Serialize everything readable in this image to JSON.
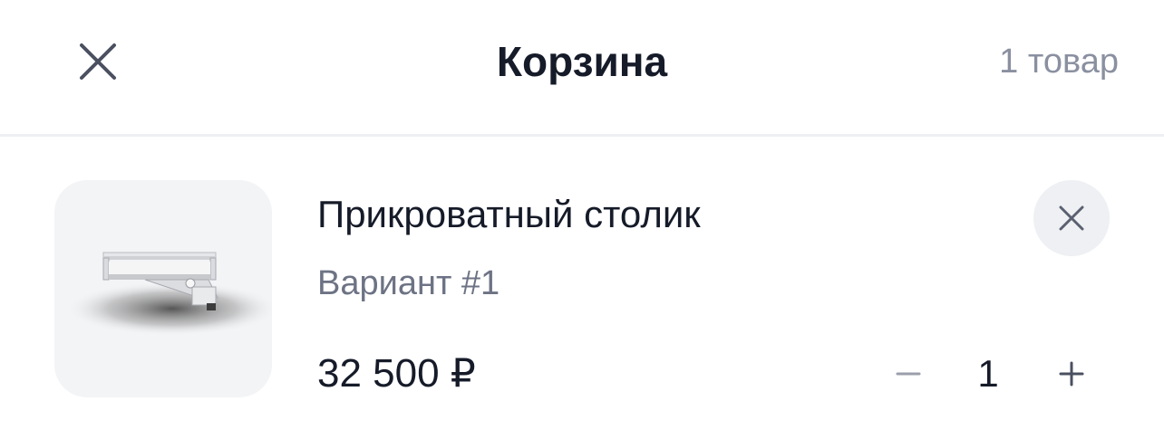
{
  "header": {
    "title": "Корзина",
    "count_label": "1 товар",
    "close_icon": "close-icon"
  },
  "cart": {
    "items": [
      {
        "name": "Прикроватный столик",
        "variant": "Вариант #1",
        "price": "32 500 ₽",
        "quantity": "1",
        "image_icon": "bedside-table-image",
        "remove_icon": "close-icon",
        "decrease_icon": "minus-icon",
        "increase_icon": "plus-icon"
      }
    ]
  },
  "colors": {
    "text_primary": "#161b29",
    "text_secondary": "#6d7384",
    "text_muted": "#8a90a0",
    "divider": "#eef0f3",
    "thumb_bg": "#f3f4f6",
    "remove_bg": "#eef0f3",
    "icon": "#5a6070"
  }
}
